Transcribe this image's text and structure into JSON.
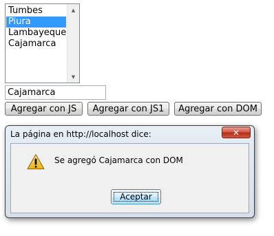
{
  "listbox": {
    "items": [
      {
        "label": "Tumbes",
        "selected": false
      },
      {
        "label": "Piura",
        "selected": true
      },
      {
        "label": "Lambayeque",
        "selected": false
      },
      {
        "label": "Cajamarca",
        "selected": false
      }
    ]
  },
  "input": {
    "value": "Cajamarca"
  },
  "buttons": {
    "js": "Agregar con JS",
    "js1": "Agregar con JS1",
    "dom": "Agregar con DOM"
  },
  "dialog": {
    "title": "La página en http://localhost dice:",
    "message": "Se agregó Cajamarca con DOM",
    "ok_label": "Aceptar",
    "close_glyph": "✕",
    "icon": "warning-icon"
  },
  "colors": {
    "selection": "#3399ff",
    "close_button": "#c8412b",
    "warning_fill": "#f5c518"
  }
}
